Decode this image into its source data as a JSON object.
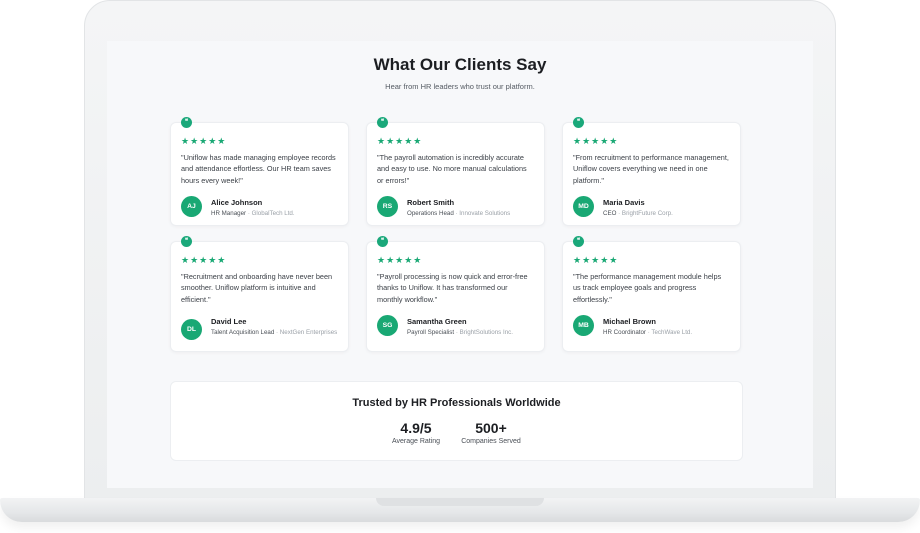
{
  "section": {
    "title": "What Our Clients Say",
    "subtitle": "Hear from HR leaders who trust our platform."
  },
  "icons": {
    "quote": "quote-icon",
    "star": "star-icon"
  },
  "colors": {
    "accent": "#19a874",
    "background": "#f7f8fa",
    "card": "#ffffff"
  },
  "testimonials": [
    {
      "rating": 5,
      "stars": "★★★★★",
      "quote": "\"Uniflow has made managing employee records and attendance effortless. Our HR team saves hours every week!\"",
      "initials": "AJ",
      "name": "Alice Johnson",
      "role": "HR Manager",
      "company": "· GlobalTech Ltd."
    },
    {
      "rating": 5,
      "stars": "★★★★★",
      "quote": "\"The payroll automation is incredibly accurate and easy to use. No more manual calculations or errors!\"",
      "initials": "RS",
      "name": "Robert Smith",
      "role": "Operations Head",
      "company": "· Innovate Solutions"
    },
    {
      "rating": 5,
      "stars": "★★★★★",
      "quote": "\"From recruitment to performance management, Uniflow covers everything we need in one platform.\"",
      "initials": "MD",
      "name": "Maria Davis",
      "role": "CEO",
      "company": "· BrightFuture Corp."
    },
    {
      "rating": 5,
      "stars": "★★★★★",
      "quote": "\"Recruitment and onboarding have never been smoother. Uniflow platform is intuitive and efficient.\"",
      "initials": "DL",
      "name": "David Lee",
      "role": "Talent Acquisition Lead",
      "company": "· NextGen Enterprises"
    },
    {
      "rating": 5,
      "stars": "★★★★★",
      "quote": "\"Payroll processing is now quick and error-free thanks to Uniflow. It has transformed our monthly workflow.\"",
      "initials": "SG",
      "name": "Samantha Green",
      "role": "Payroll Specialist",
      "company": "· BrightSolutions Inc."
    },
    {
      "rating": 5,
      "stars": "★★★★★",
      "quote": "\"The performance management module helps us track employee goals and progress effortlessly.\"",
      "initials": "MB",
      "name": "Michael Brown",
      "role": "HR Coordinator",
      "company": "· TechWave Ltd."
    }
  ],
  "trust": {
    "title": "Trusted by HR Professionals Worldwide",
    "stats": [
      {
        "value": "4.9/5",
        "label": "Average Rating"
      },
      {
        "value": "500+",
        "label": "Companies Served"
      }
    ]
  }
}
